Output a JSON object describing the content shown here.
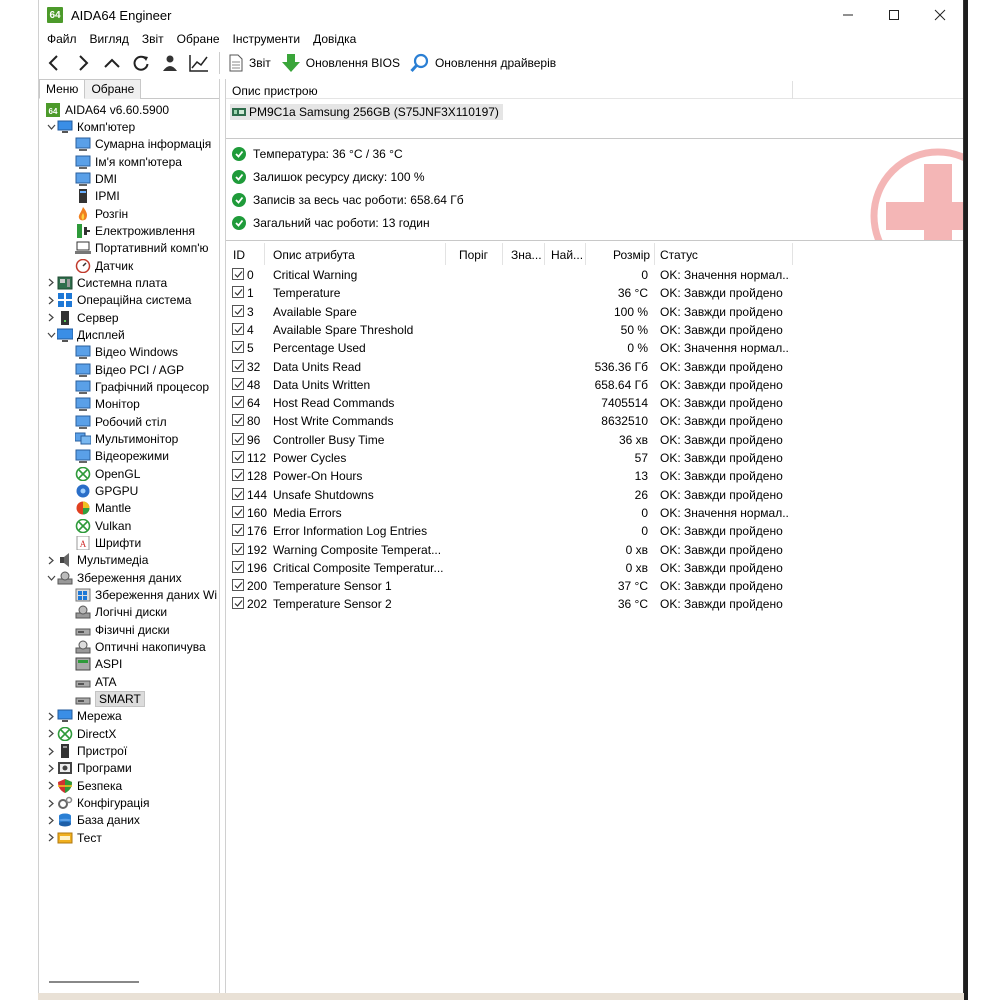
{
  "window": {
    "title": "AIDA64 Engineer",
    "logo": "64"
  },
  "menu": [
    "Файл",
    "Вигляд",
    "Звіт",
    "Обране",
    "Інструменти",
    "Довідка"
  ],
  "toolbar": {
    "report": "Звіт",
    "bios_update": "Оновлення BIOS",
    "driver_update": "Оновлення драйверів"
  },
  "tabs": {
    "menu": "Меню",
    "favorites": "Обране"
  },
  "tree": [
    {
      "label": "AIDA64 v6.60.5900",
      "depth": 0,
      "exp": "",
      "icon": "aida-icon"
    },
    {
      "label": "Комп'ютер",
      "depth": 0,
      "exp": "v",
      "icon": "computer-icon"
    },
    {
      "label": "Сумарна інформація",
      "depth": 1,
      "exp": "",
      "icon": "summary-icon"
    },
    {
      "label": "Ім'я комп'ютера",
      "depth": 1,
      "exp": "",
      "icon": "computer-name-icon"
    },
    {
      "label": "DMI",
      "depth": 1,
      "exp": "",
      "icon": "dmi-icon"
    },
    {
      "label": "IPMI",
      "depth": 1,
      "exp": "",
      "icon": "ipmi-icon"
    },
    {
      "label": "Розгін",
      "depth": 1,
      "exp": "",
      "icon": "flame-icon"
    },
    {
      "label": "Електроживлення",
      "depth": 1,
      "exp": "",
      "icon": "power-icon"
    },
    {
      "label": "Портативний комп'ю",
      "depth": 1,
      "exp": "",
      "icon": "laptop-icon"
    },
    {
      "label": "Датчик",
      "depth": 1,
      "exp": "",
      "icon": "sensor-icon"
    },
    {
      "label": "Системна плата",
      "depth": 0,
      "exp": ">",
      "icon": "motherboard-icon"
    },
    {
      "label": "Операційна система",
      "depth": 0,
      "exp": ">",
      "icon": "windows-icon"
    },
    {
      "label": "Сервер",
      "depth": 0,
      "exp": ">",
      "icon": "server-icon"
    },
    {
      "label": "Дисплей",
      "depth": 0,
      "exp": "v",
      "icon": "display-icon"
    },
    {
      "label": "Відео Windows",
      "depth": 1,
      "exp": "",
      "icon": "video-icon"
    },
    {
      "label": "Відео PCI / AGP",
      "depth": 1,
      "exp": "",
      "icon": "video-icon"
    },
    {
      "label": "Графічний процесор",
      "depth": 1,
      "exp": "",
      "icon": "gpu-icon"
    },
    {
      "label": "Монітор",
      "depth": 1,
      "exp": "",
      "icon": "monitor-icon"
    },
    {
      "label": "Робочий стіл",
      "depth": 1,
      "exp": "",
      "icon": "desktop-icon"
    },
    {
      "label": "Мультимонітор",
      "depth": 1,
      "exp": "",
      "icon": "multimonitor-icon"
    },
    {
      "label": "Відеорежими",
      "depth": 1,
      "exp": "",
      "icon": "video-modes-icon"
    },
    {
      "label": "OpenGL",
      "depth": 1,
      "exp": "",
      "icon": "xbox-icon"
    },
    {
      "label": "GPGPU",
      "depth": 1,
      "exp": "",
      "icon": "gpgpu-icon"
    },
    {
      "label": "Mantle",
      "depth": 1,
      "exp": "",
      "icon": "mantle-icon"
    },
    {
      "label": "Vulkan",
      "depth": 1,
      "exp": "",
      "icon": "xbox-icon"
    },
    {
      "label": "Шрифти",
      "depth": 1,
      "exp": "",
      "icon": "font-icon"
    },
    {
      "label": "Мультимедіа",
      "depth": 0,
      "exp": ">",
      "icon": "speaker-icon"
    },
    {
      "label": "Збереження даних",
      "depth": 0,
      "exp": "v",
      "icon": "storage-icon"
    },
    {
      "label": "Збереження даних Wi",
      "depth": 1,
      "exp": "",
      "icon": "storage-windows-icon"
    },
    {
      "label": "Логічні диски",
      "depth": 1,
      "exp": "",
      "icon": "logical-disk-icon"
    },
    {
      "label": "Фізичні диски",
      "depth": 1,
      "exp": "",
      "icon": "physical-disk-icon"
    },
    {
      "label": "Оптичні накопичува",
      "depth": 1,
      "exp": "",
      "icon": "optical-drive-icon"
    },
    {
      "label": "ASPI",
      "depth": 1,
      "exp": "",
      "icon": "aspi-icon"
    },
    {
      "label": "ATA",
      "depth": 1,
      "exp": "",
      "icon": "ata-icon"
    },
    {
      "label": "SMART",
      "depth": 1,
      "exp": "",
      "icon": "smart-icon",
      "selected": true
    },
    {
      "label": "Мережа",
      "depth": 0,
      "exp": ">",
      "icon": "network-icon"
    },
    {
      "label": "DirectX",
      "depth": 0,
      "exp": ">",
      "icon": "xbox-icon"
    },
    {
      "label": "Пристрої",
      "depth": 0,
      "exp": ">",
      "icon": "devices-icon"
    },
    {
      "label": "Програми",
      "depth": 0,
      "exp": ">",
      "icon": "programs-icon"
    },
    {
      "label": "Безпека",
      "depth": 0,
      "exp": ">",
      "icon": "security-shield-icon"
    },
    {
      "label": "Конфігурація",
      "depth": 0,
      "exp": ">",
      "icon": "config-icon"
    },
    {
      "label": "База даних",
      "depth": 0,
      "exp": ">",
      "icon": "database-icon"
    },
    {
      "label": "Тест",
      "depth": 0,
      "exp": ">",
      "icon": "test-icon"
    }
  ],
  "device": {
    "header": "Опис пристрою",
    "name": "PM9C1a Samsung 256GB (S75JNF3X110197)"
  },
  "summary": [
    "Температура: 36 °C / 36 °C",
    "Залишок ресурсу диску: 100 %",
    "Записів за весь час роботи: 658.64 Гб",
    "Загальний час роботи: 13 годин"
  ],
  "columns": {
    "id": "ID",
    "name": "Опис атрибута",
    "threshold": "Поріг",
    "value": "Зна...",
    "worst": "Най...",
    "raw": "Розмір",
    "status": "Статус"
  },
  "attributes": [
    {
      "id": "0",
      "name": "Critical Warning",
      "raw": "0",
      "status": "OK: Значення нормал..."
    },
    {
      "id": "1",
      "name": "Temperature",
      "raw": "36 °C",
      "status": "OK: Завжди пройдено"
    },
    {
      "id": "3",
      "name": "Available Spare",
      "raw": "100 %",
      "status": "OK: Завжди пройдено"
    },
    {
      "id": "4",
      "name": "Available Spare Threshold",
      "raw": "50 %",
      "status": "OK: Завжди пройдено"
    },
    {
      "id": "5",
      "name": "Percentage Used",
      "raw": "0 %",
      "status": "OK: Значення нормал..."
    },
    {
      "id": "32",
      "name": "Data Units Read",
      "raw": "536.36 Гб",
      "status": "OK: Завжди пройдено"
    },
    {
      "id": "48",
      "name": "Data Units Written",
      "raw": "658.64 Гб",
      "status": "OK: Завжди пройдено"
    },
    {
      "id": "64",
      "name": "Host Read Commands",
      "raw": "7405514",
      "status": "OK: Завжди пройдено"
    },
    {
      "id": "80",
      "name": "Host Write Commands",
      "raw": "8632510",
      "status": "OK: Завжди пройдено"
    },
    {
      "id": "96",
      "name": "Controller Busy Time",
      "raw": "36 хв",
      "status": "OK: Завжди пройдено"
    },
    {
      "id": "112",
      "name": "Power Cycles",
      "raw": "57",
      "status": "OK: Завжди пройдено"
    },
    {
      "id": "128",
      "name": "Power-On Hours",
      "raw": "13",
      "status": "OK: Завжди пройдено"
    },
    {
      "id": "144",
      "name": "Unsafe Shutdowns",
      "raw": "26",
      "status": "OK: Завжди пройдено"
    },
    {
      "id": "160",
      "name": "Media Errors",
      "raw": "0",
      "status": "OK: Значення нормал..."
    },
    {
      "id": "176",
      "name": "Error Information Log Entries",
      "raw": "0",
      "status": "OK: Завжди пройдено"
    },
    {
      "id": "192",
      "name": "Warning Composite Temperat...",
      "raw": "0 хв",
      "status": "OK: Завжди пройдено"
    },
    {
      "id": "196",
      "name": "Critical Composite Temperatur...",
      "raw": "0 хв",
      "status": "OK: Завжди пройдено"
    },
    {
      "id": "200",
      "name": "Temperature Sensor 1",
      "raw": "37 °C",
      "status": "OK: Завжди пройдено"
    },
    {
      "id": "202",
      "name": "Temperature Sensor 2",
      "raw": "36 °C",
      "status": "OK: Завжди пройдено"
    }
  ],
  "colors": {
    "ok_green": "#1f9b3a",
    "logo_green": "#4c9a2a",
    "selection": "#dcdcdc",
    "watermark": "#f4b6b6"
  }
}
